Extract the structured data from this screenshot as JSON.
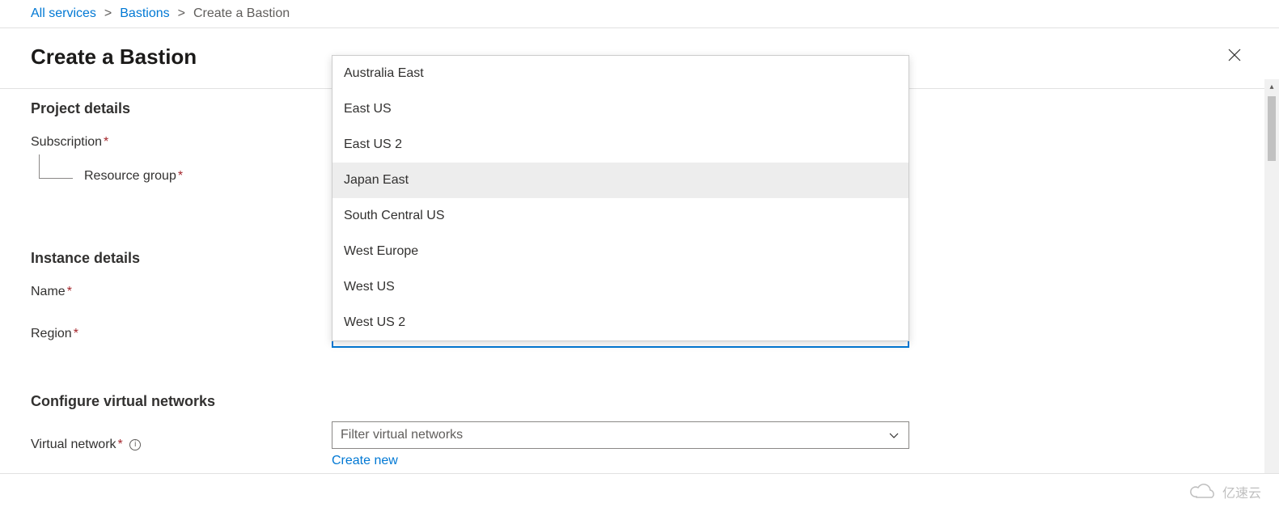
{
  "breadcrumb": {
    "items": [
      "All services",
      "Bastions"
    ],
    "current": "Create a Bastion"
  },
  "page": {
    "title": "Create a Bastion"
  },
  "sections": {
    "project": {
      "title": "Project details",
      "subscription_label": "Subscription",
      "resource_group_label": "Resource group"
    },
    "instance": {
      "title": "Instance details",
      "name_label": "Name",
      "region_label": "Region",
      "region_value": "Japan East"
    },
    "vnet": {
      "title": "Configure virtual networks",
      "vnet_label": "Virtual network",
      "vnet_placeholder": "Filter virtual networks",
      "create_new": "Create new"
    }
  },
  "region_options": [
    "Australia East",
    "East US",
    "East US 2",
    "Japan East",
    "South Central US",
    "West Europe",
    "West US",
    "West US 2"
  ],
  "region_hover_index": 3,
  "watermark": "亿速云"
}
